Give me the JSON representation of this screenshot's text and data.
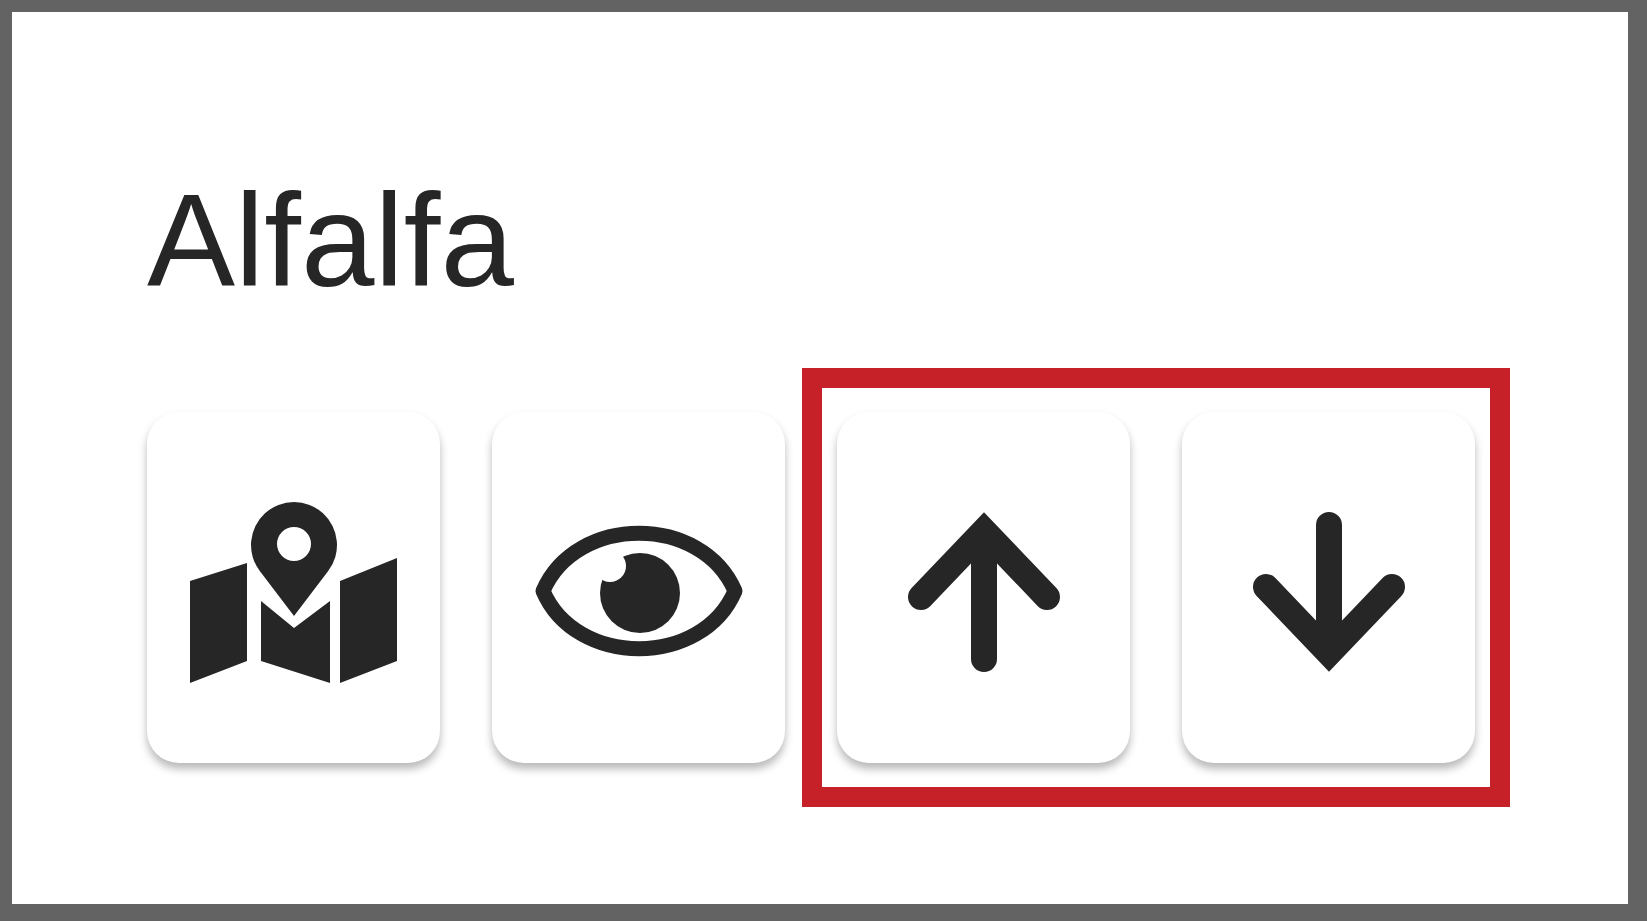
{
  "title": "Alfalfa",
  "buttons": [
    {
      "kind": "map",
      "highlighted": false
    },
    {
      "kind": "eye",
      "highlighted": false
    },
    {
      "kind": "arrow-up",
      "highlighted": true
    },
    {
      "kind": "arrow-down",
      "highlighted": true
    }
  ]
}
